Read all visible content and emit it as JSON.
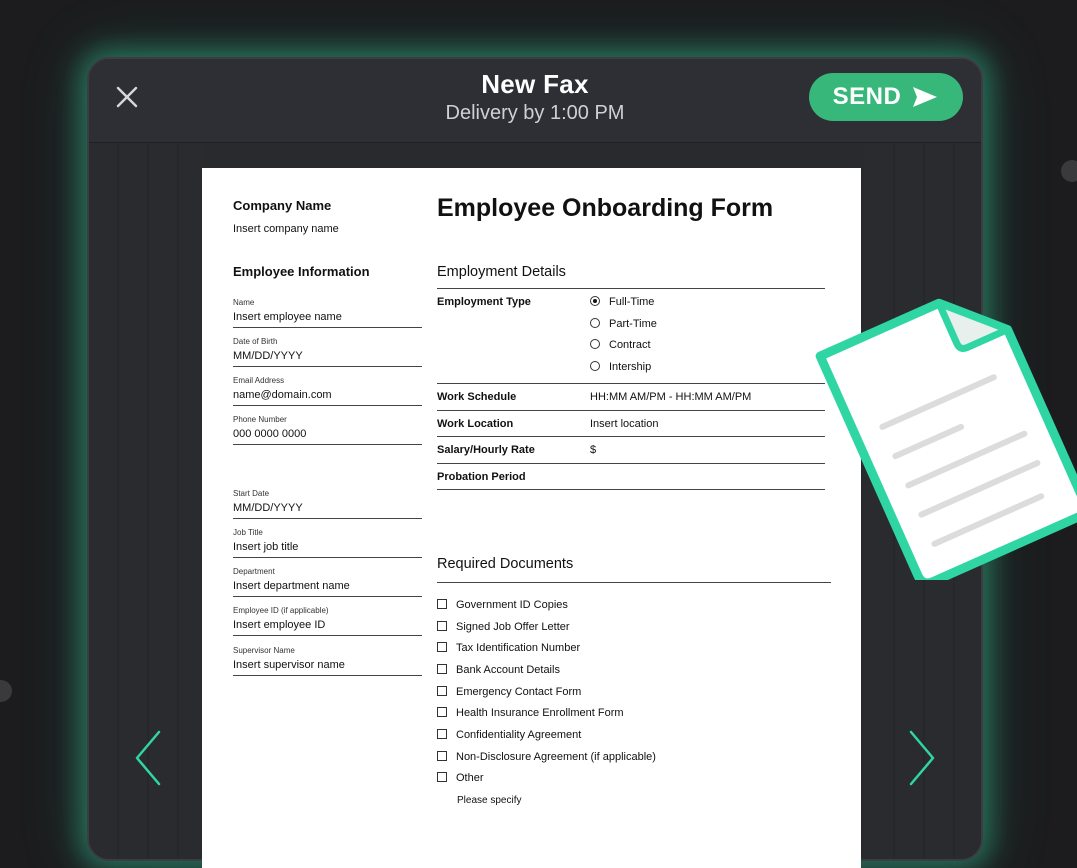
{
  "header": {
    "title": "New Fax",
    "subtitle": "Delivery by 1:00 PM",
    "send_label": "SEND"
  },
  "colors": {
    "accent": "#37b87a",
    "glow": "#34c896",
    "doc_border": "#2fd6a3"
  },
  "icons": {
    "close": "close-icon",
    "send": "send-arrow-icon",
    "prev": "chevron-left-icon",
    "next": "chevron-right-icon",
    "document": "document-icon"
  },
  "form": {
    "company_heading": "Company Name",
    "company_value": "Insert company name",
    "title": "Employee Onboarding Form",
    "employee_info": {
      "heading": "Employee Information",
      "fields": [
        {
          "label": "Name",
          "value": "Insert employee name"
        },
        {
          "label": "Date of Birth",
          "value": "MM/DD/YYYY"
        },
        {
          "label": "Email Address",
          "value": "name@domain.com"
        },
        {
          "label": "Phone Number",
          "value": "000 0000 0000"
        },
        {
          "label": "Start Date",
          "value": "MM/DD/YYYY"
        },
        {
          "label": "Job Title",
          "value": "Insert job title"
        },
        {
          "label": "Department",
          "value": "Insert department name"
        },
        {
          "label": "Employee ID (if applicable)",
          "value": "Insert employee ID"
        },
        {
          "label": "Supervisor Name",
          "value": "Insert supervisor name"
        }
      ]
    },
    "employment": {
      "heading": "Employment Details",
      "type_label": "Employment Type",
      "type_options": [
        "Full-Time",
        "Part-Time",
        "Contract",
        "Intership"
      ],
      "type_selected": "Full-Time",
      "rows": [
        {
          "key": "Work Schedule",
          "value": "HH:MM AM/PM - HH:MM AM/PM"
        },
        {
          "key": "Work Location",
          "value": "Insert location"
        },
        {
          "key": "Salary/Hourly Rate",
          "value": "$"
        },
        {
          "key": "Probation Period",
          "value": ""
        }
      ]
    },
    "documents": {
      "heading": "Required Documents",
      "items": [
        "Government ID Copies",
        "Signed Job Offer Letter",
        "Tax Identification Number",
        "Bank Account Details",
        "Emergency Contact Form",
        "Health Insurance Enrollment Form",
        "Confidentiality Agreement",
        "Non-Disclosure Agreement (if applicable)",
        "Other"
      ],
      "specify": "Please specify"
    }
  }
}
